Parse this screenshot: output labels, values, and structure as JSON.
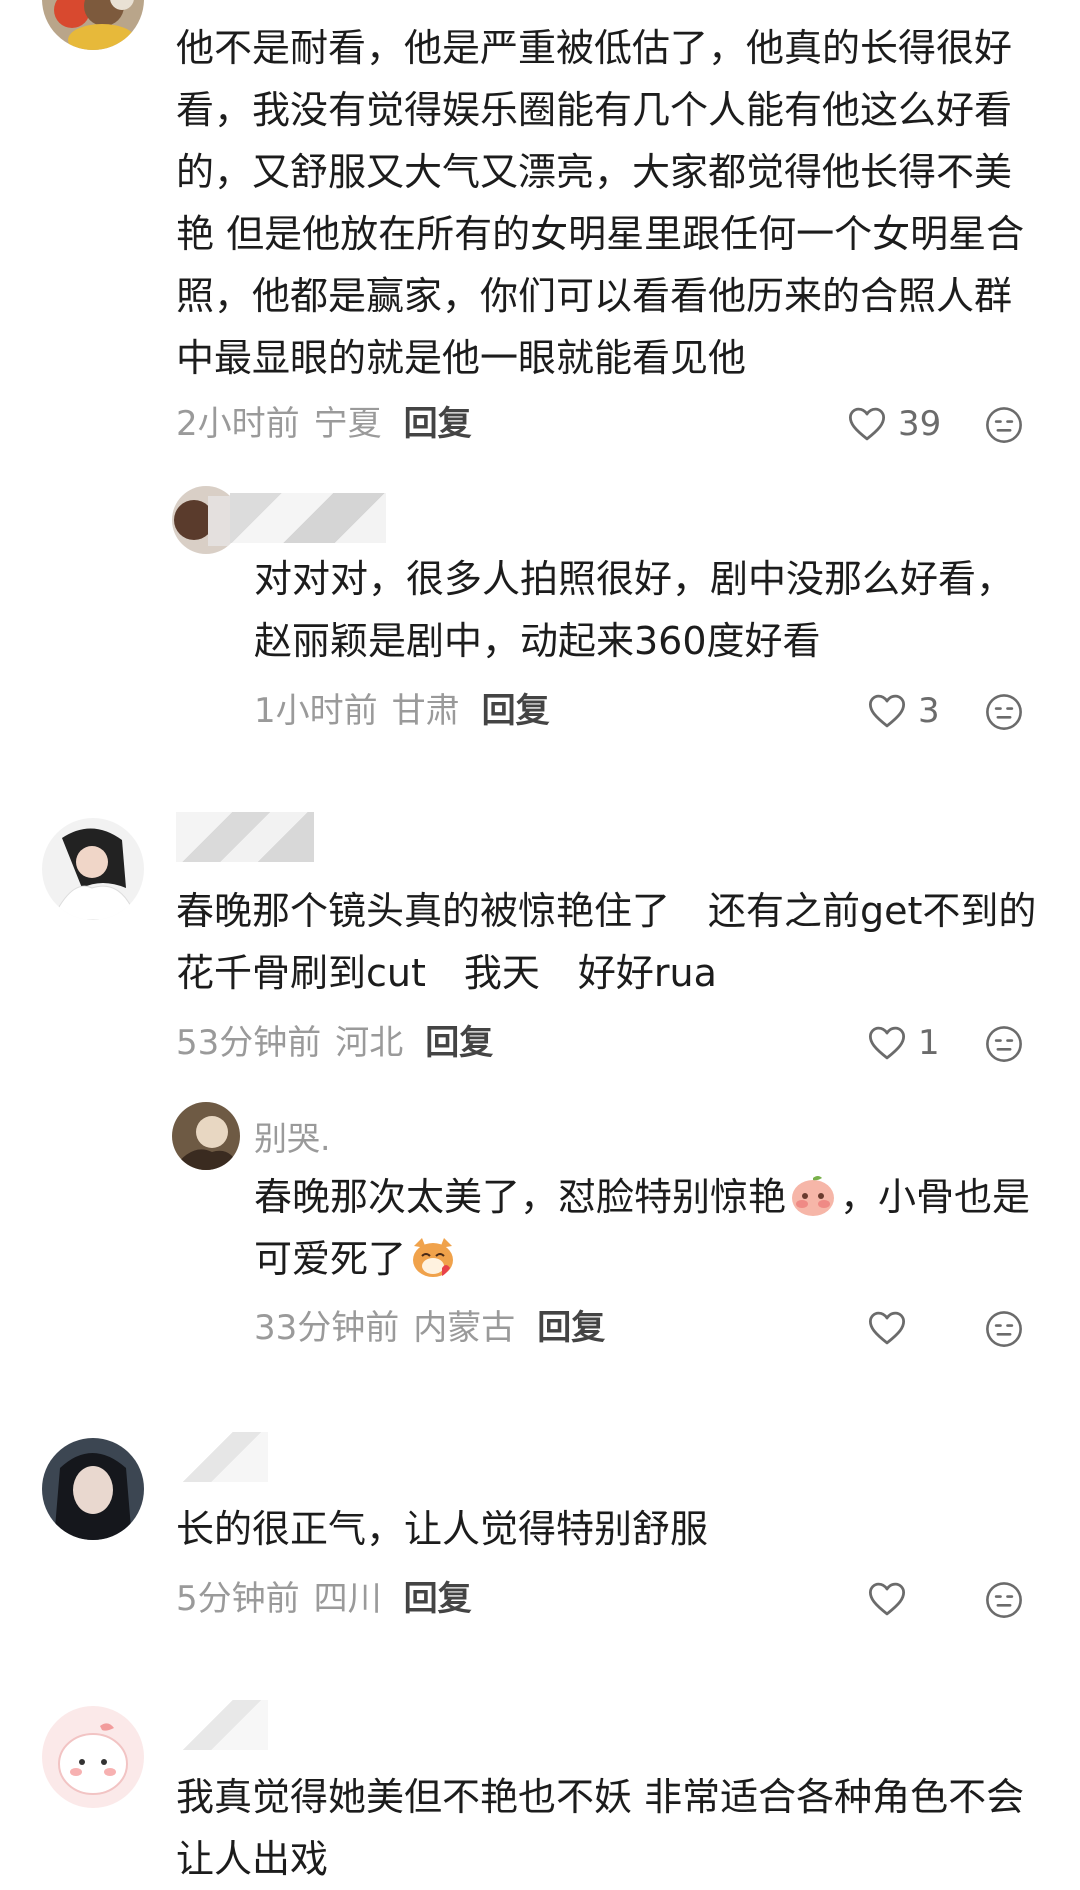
{
  "comments": [
    {
      "text": "他不是耐看，他是严重被低估了，他真的长得很好看，我没有觉得娱乐圈能有几个人能有他这么好看的，又舒服又大气又漂亮，大家都觉得他长得不美艳 但是他放在所有的女明星里跟任何一个女明星合照，他都是赢家，你们可以看看他历来的合照人群中最显眼的就是他一眼就能看见他",
      "time": "2小时前",
      "location": "宁夏",
      "reply_label": "回复",
      "likes": "39",
      "replies": [
        {
          "text": "对对对，很多人拍照很好，剧中没那么好看，赵丽颖是剧中，动起来360度好看",
          "time": "1小时前",
          "location": "甘肃",
          "reply_label": "回复",
          "likes": "3"
        }
      ]
    },
    {
      "text": "春晚那个镜头真的被惊艳住了　还有之前get不到的花千骨刷到cut　我天　好好rua",
      "time": "53分钟前",
      "location": "河北",
      "reply_label": "回复",
      "likes": "1",
      "replies": [
        {
          "username": "别哭.",
          "text_part1": "春晚那次太美了，怼脸特别惊艳",
          "text_part2": "，小骨也是可爱死了",
          "time": "33分钟前",
          "location": "内蒙古",
          "reply_label": "回复",
          "likes": ""
        }
      ]
    },
    {
      "text": "长的很正气，让人觉得特别舒服",
      "time": "5分钟前",
      "location": "四川",
      "reply_label": "回复",
      "likes": ""
    },
    {
      "text": "我真觉得她美但不艳也不妖 非常适合各种角色不会让人出戏"
    }
  ],
  "icons": {
    "like": "heart-outline-icon",
    "dislike": "meh-face-icon",
    "emoji1": "peach-shy-emoji",
    "emoji2": "cat-heart-emoji"
  },
  "colors": {
    "meta_gray": "#9a9a9a",
    "reply": "#444444",
    "text": "#1c1c1c"
  }
}
